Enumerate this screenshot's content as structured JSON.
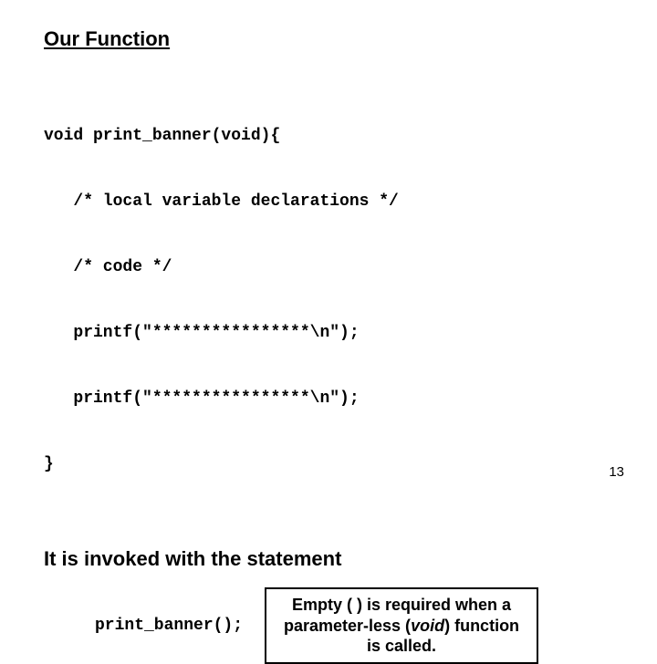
{
  "heading": "Our Function",
  "code": {
    "l1": "void print_banner(void){",
    "l2": "   /* local variable declarations */",
    "l3": "   /* code */",
    "l4": "   printf(\"****************\\n\");",
    "l5": "   printf(\"****************\\n\");",
    "l6": "}"
  },
  "invokedText": "It is invoked with the statement",
  "invokeCode": "print_banner();",
  "callout": {
    "part1": "Empty ( ) is required when a parameter-less (",
    "voidWord": "void",
    "part2": ") function is called."
  },
  "pageNumber": "13"
}
